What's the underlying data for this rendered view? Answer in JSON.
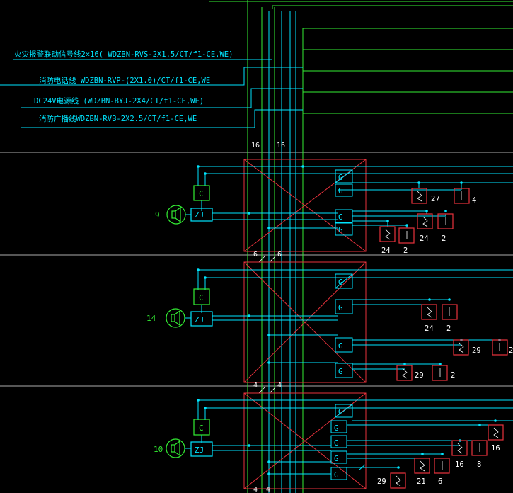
{
  "colors": {
    "background": "#000000",
    "cyan": "#00e5ff",
    "green": "#33ee33",
    "red": "#e8323c",
    "white": "#ffffff"
  },
  "legend": {
    "line1": "火灾报警联动信号线2×16( WDZBN-RVS-2X1.5/CT/f1-CE,WE)",
    "line2": "消防电话线 WDZBN-RVP-(2X1.0)/CT/f1-CE,WE",
    "line3": "DC24V电源线 (WDZBN-BYJ-2X4/CT/f1-CE,WE)",
    "line4": "消防广播线WDZBN-RVB-2X2.5/CT/f1-CE,WE"
  },
  "riser_counts": [
    "16",
    "16"
  ],
  "floors": [
    {
      "speaker_count": "9",
      "module_c": "C",
      "module_zj": "ZJ",
      "riser_top": [
        "6",
        "6"
      ],
      "device_counts": [
        "27",
        "4",
        "24",
        "2",
        "24",
        "2"
      ]
    },
    {
      "speaker_count": "14",
      "module_c": "C",
      "module_zj": "ZJ",
      "riser_top": [
        "4",
        "4"
      ],
      "device_counts": [
        "24",
        "2",
        "29",
        "2",
        "29",
        "2"
      ]
    },
    {
      "speaker_count": "10",
      "module_c": "C",
      "module_zj": "ZJ",
      "riser_top": [
        "4",
        "4"
      ],
      "device_counts": [
        "16",
        "16",
        "8",
        "29",
        "21",
        "6"
      ]
    }
  ],
  "isolator_label": "G",
  "icons": [
    "speaker-icon",
    "smoke-detector-icon",
    "manual-alarm-button-icon",
    "isolator-module-icon"
  ]
}
